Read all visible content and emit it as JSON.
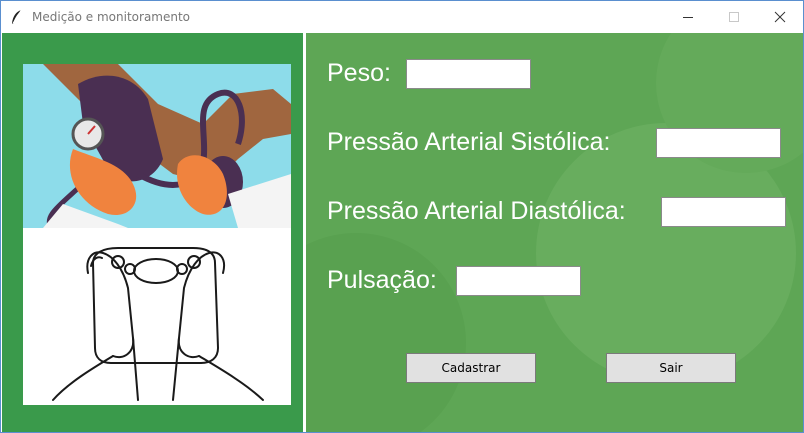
{
  "window": {
    "title": "Medição e monitoramento",
    "icon": "feather-icon",
    "controls": [
      "minimize-icon",
      "maximize-icon",
      "close-icon"
    ]
  },
  "illustration": {
    "top_image": "blood-pressure-measurement",
    "bottom_image": "bathroom-scale-feet"
  },
  "form": {
    "peso_label": "Peso:",
    "peso_value": "",
    "sistolica_label": "Pressão Arterial Sistólica:",
    "sistolica_value": "",
    "diastolica_label": "Pressão Arterial Diastólica:",
    "diastolica_value": "",
    "pulsacao_label": "Pulsação:",
    "pulsacao_value": ""
  },
  "buttons": {
    "cadastrar": "Cadastrar",
    "sair": "Sair"
  },
  "colors": {
    "left_panel": "#3a9a4b",
    "right_panel": "#5ea655",
    "button_bg": "#e1e1e1"
  }
}
